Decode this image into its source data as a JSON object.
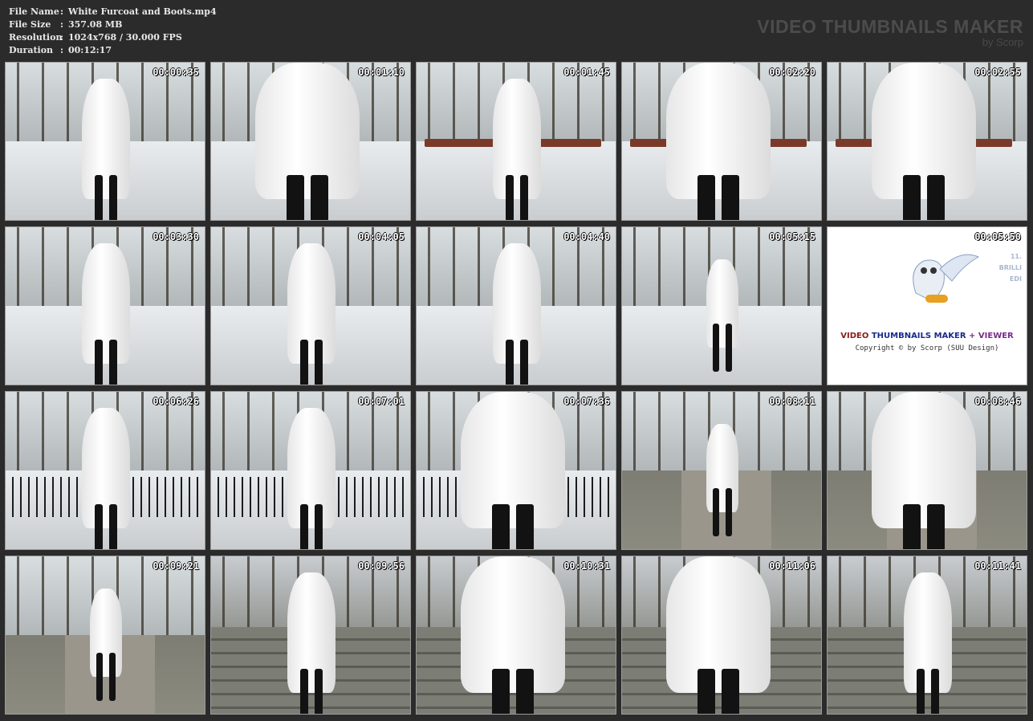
{
  "file_info": [
    {
      "key": "File Name",
      "sep": ":",
      "value": "White Furcoat and Boots.mp4"
    },
    {
      "key": "File Size",
      "sep": ":",
      "value": "357.08 MB"
    },
    {
      "key": "Resolution",
      "sep": ":",
      "value": "1024x768 / 30.000 FPS"
    },
    {
      "key": "Duration",
      "sep": ":",
      "value": "00:12:17"
    }
  ],
  "brand": {
    "title": "VIDEO THUMBNAILS MAKER",
    "subtitle": "by Scorp"
  },
  "thumbnails": [
    {
      "time": "00:00:35",
      "scene": "snow-park"
    },
    {
      "time": "00:01:10",
      "scene": "snow-closeup"
    },
    {
      "time": "00:01:45",
      "scene": "bench"
    },
    {
      "time": "00:02:20",
      "scene": "bench-closeup"
    },
    {
      "time": "00:02:55",
      "scene": "bench-seated"
    },
    {
      "time": "00:03:30",
      "scene": "snow-path"
    },
    {
      "time": "00:04:05",
      "scene": "snow-path"
    },
    {
      "time": "00:04:40",
      "scene": "snow-pond"
    },
    {
      "time": "00:05:15",
      "scene": "park-alley"
    },
    {
      "time": "00:05:50",
      "scene": "logo"
    },
    {
      "time": "00:06:26",
      "scene": "fence"
    },
    {
      "time": "00:07:01",
      "scene": "fence-sky"
    },
    {
      "time": "00:07:36",
      "scene": "fence-closeup"
    },
    {
      "time": "00:08:11",
      "scene": "sidewalk"
    },
    {
      "time": "00:08:46",
      "scene": "sidewalk-close"
    },
    {
      "time": "00:09:21",
      "scene": "sidewalk"
    },
    {
      "time": "00:09:56",
      "scene": "stairs"
    },
    {
      "time": "00:10:31",
      "scene": "stairs-close"
    },
    {
      "time": "00:11:06",
      "scene": "stairs-boots"
    },
    {
      "time": "00:11:41",
      "scene": "stairs-railing"
    }
  ],
  "logo_panel": {
    "title_part1": "VIDEO",
    "title_part2": "THUMBNAILS MAKER",
    "title_part3": "+ VIEWER",
    "copyright": "Copyright © by Scorp (SUU Design)",
    "side_line1": "11.",
    "side_line2": "BRILLI",
    "side_line3": "EDI",
    "colors": {
      "video": "#8b1a1a",
      "thumbnails": "#1a2a8b",
      "viewer": "#7a2a8b"
    }
  }
}
